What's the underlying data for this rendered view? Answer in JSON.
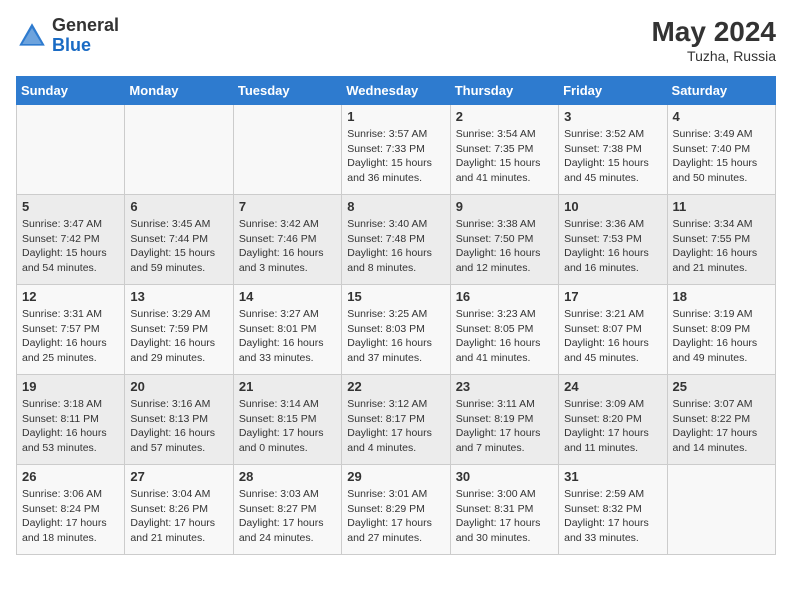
{
  "header": {
    "logo_general": "General",
    "logo_blue": "Blue",
    "month_year": "May 2024",
    "location": "Tuzha, Russia"
  },
  "days_of_week": [
    "Sunday",
    "Monday",
    "Tuesday",
    "Wednesday",
    "Thursday",
    "Friday",
    "Saturday"
  ],
  "weeks": [
    [
      null,
      null,
      null,
      {
        "day": "1",
        "sunrise": "Sunrise: 3:57 AM",
        "sunset": "Sunset: 7:33 PM",
        "daylight": "Daylight: 15 hours and 36 minutes."
      },
      {
        "day": "2",
        "sunrise": "Sunrise: 3:54 AM",
        "sunset": "Sunset: 7:35 PM",
        "daylight": "Daylight: 15 hours and 41 minutes."
      },
      {
        "day": "3",
        "sunrise": "Sunrise: 3:52 AM",
        "sunset": "Sunset: 7:38 PM",
        "daylight": "Daylight: 15 hours and 45 minutes."
      },
      {
        "day": "4",
        "sunrise": "Sunrise: 3:49 AM",
        "sunset": "Sunset: 7:40 PM",
        "daylight": "Daylight: 15 hours and 50 minutes."
      }
    ],
    [
      {
        "day": "5",
        "sunrise": "Sunrise: 3:47 AM",
        "sunset": "Sunset: 7:42 PM",
        "daylight": "Daylight: 15 hours and 54 minutes."
      },
      {
        "day": "6",
        "sunrise": "Sunrise: 3:45 AM",
        "sunset": "Sunset: 7:44 PM",
        "daylight": "Daylight: 15 hours and 59 minutes."
      },
      {
        "day": "7",
        "sunrise": "Sunrise: 3:42 AM",
        "sunset": "Sunset: 7:46 PM",
        "daylight": "Daylight: 16 hours and 3 minutes."
      },
      {
        "day": "8",
        "sunrise": "Sunrise: 3:40 AM",
        "sunset": "Sunset: 7:48 PM",
        "daylight": "Daylight: 16 hours and 8 minutes."
      },
      {
        "day": "9",
        "sunrise": "Sunrise: 3:38 AM",
        "sunset": "Sunset: 7:50 PM",
        "daylight": "Daylight: 16 hours and 12 minutes."
      },
      {
        "day": "10",
        "sunrise": "Sunrise: 3:36 AM",
        "sunset": "Sunset: 7:53 PM",
        "daylight": "Daylight: 16 hours and 16 minutes."
      },
      {
        "day": "11",
        "sunrise": "Sunrise: 3:34 AM",
        "sunset": "Sunset: 7:55 PM",
        "daylight": "Daylight: 16 hours and 21 minutes."
      }
    ],
    [
      {
        "day": "12",
        "sunrise": "Sunrise: 3:31 AM",
        "sunset": "Sunset: 7:57 PM",
        "daylight": "Daylight: 16 hours and 25 minutes."
      },
      {
        "day": "13",
        "sunrise": "Sunrise: 3:29 AM",
        "sunset": "Sunset: 7:59 PM",
        "daylight": "Daylight: 16 hours and 29 minutes."
      },
      {
        "day": "14",
        "sunrise": "Sunrise: 3:27 AM",
        "sunset": "Sunset: 8:01 PM",
        "daylight": "Daylight: 16 hours and 33 minutes."
      },
      {
        "day": "15",
        "sunrise": "Sunrise: 3:25 AM",
        "sunset": "Sunset: 8:03 PM",
        "daylight": "Daylight: 16 hours and 37 minutes."
      },
      {
        "day": "16",
        "sunrise": "Sunrise: 3:23 AM",
        "sunset": "Sunset: 8:05 PM",
        "daylight": "Daylight: 16 hours and 41 minutes."
      },
      {
        "day": "17",
        "sunrise": "Sunrise: 3:21 AM",
        "sunset": "Sunset: 8:07 PM",
        "daylight": "Daylight: 16 hours and 45 minutes."
      },
      {
        "day": "18",
        "sunrise": "Sunrise: 3:19 AM",
        "sunset": "Sunset: 8:09 PM",
        "daylight": "Daylight: 16 hours and 49 minutes."
      }
    ],
    [
      {
        "day": "19",
        "sunrise": "Sunrise: 3:18 AM",
        "sunset": "Sunset: 8:11 PM",
        "daylight": "Daylight: 16 hours and 53 minutes."
      },
      {
        "day": "20",
        "sunrise": "Sunrise: 3:16 AM",
        "sunset": "Sunset: 8:13 PM",
        "daylight": "Daylight: 16 hours and 57 minutes."
      },
      {
        "day": "21",
        "sunrise": "Sunrise: 3:14 AM",
        "sunset": "Sunset: 8:15 PM",
        "daylight": "Daylight: 17 hours and 0 minutes."
      },
      {
        "day": "22",
        "sunrise": "Sunrise: 3:12 AM",
        "sunset": "Sunset: 8:17 PM",
        "daylight": "Daylight: 17 hours and 4 minutes."
      },
      {
        "day": "23",
        "sunrise": "Sunrise: 3:11 AM",
        "sunset": "Sunset: 8:19 PM",
        "daylight": "Daylight: 17 hours and 7 minutes."
      },
      {
        "day": "24",
        "sunrise": "Sunrise: 3:09 AM",
        "sunset": "Sunset: 8:20 PM",
        "daylight": "Daylight: 17 hours and 11 minutes."
      },
      {
        "day": "25",
        "sunrise": "Sunrise: 3:07 AM",
        "sunset": "Sunset: 8:22 PM",
        "daylight": "Daylight: 17 hours and 14 minutes."
      }
    ],
    [
      {
        "day": "26",
        "sunrise": "Sunrise: 3:06 AM",
        "sunset": "Sunset: 8:24 PM",
        "daylight": "Daylight: 17 hours and 18 minutes."
      },
      {
        "day": "27",
        "sunrise": "Sunrise: 3:04 AM",
        "sunset": "Sunset: 8:26 PM",
        "daylight": "Daylight: 17 hours and 21 minutes."
      },
      {
        "day": "28",
        "sunrise": "Sunrise: 3:03 AM",
        "sunset": "Sunset: 8:27 PM",
        "daylight": "Daylight: 17 hours and 24 minutes."
      },
      {
        "day": "29",
        "sunrise": "Sunrise: 3:01 AM",
        "sunset": "Sunset: 8:29 PM",
        "daylight": "Daylight: 17 hours and 27 minutes."
      },
      {
        "day": "30",
        "sunrise": "Sunrise: 3:00 AM",
        "sunset": "Sunset: 8:31 PM",
        "daylight": "Daylight: 17 hours and 30 minutes."
      },
      {
        "day": "31",
        "sunrise": "Sunrise: 2:59 AM",
        "sunset": "Sunset: 8:32 PM",
        "daylight": "Daylight: 17 hours and 33 minutes."
      },
      null
    ]
  ]
}
